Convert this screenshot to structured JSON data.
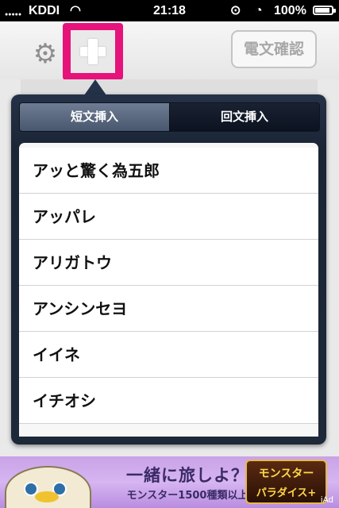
{
  "status": {
    "signal": "●●●●●",
    "carrier": "KDDI",
    "wifi": "◠",
    "time": "21:18",
    "lock_icon": "⊙",
    "alarm_icon": "◔",
    "battery_text": "100%",
    "battery_level": 1.0
  },
  "toolbar": {
    "settings_icon": "gear-icon",
    "settings_glyph": "⚙",
    "add_icon": "plus-icon",
    "confirm_label": "電文確認"
  },
  "popover": {
    "tabs": [
      {
        "label": "短文挿入",
        "selected": true
      },
      {
        "label": "回文挿入",
        "selected": false
      }
    ],
    "items": [
      "アッと驚く為五郎",
      "アッパレ",
      "アリガトウ",
      "アンシンセヨ",
      "イイネ",
      "イチオシ"
    ]
  },
  "ad": {
    "line1": "一緒に旅しよ？",
    "line2": "モンスター1500種類以上",
    "logo_line1": "モンスター",
    "logo_line2": "パラダイス+",
    "badge": "iAd"
  },
  "colors": {
    "accent_highlight": "#e6137b",
    "popover_bg": "#1d2838",
    "status_bg": "#000000"
  }
}
